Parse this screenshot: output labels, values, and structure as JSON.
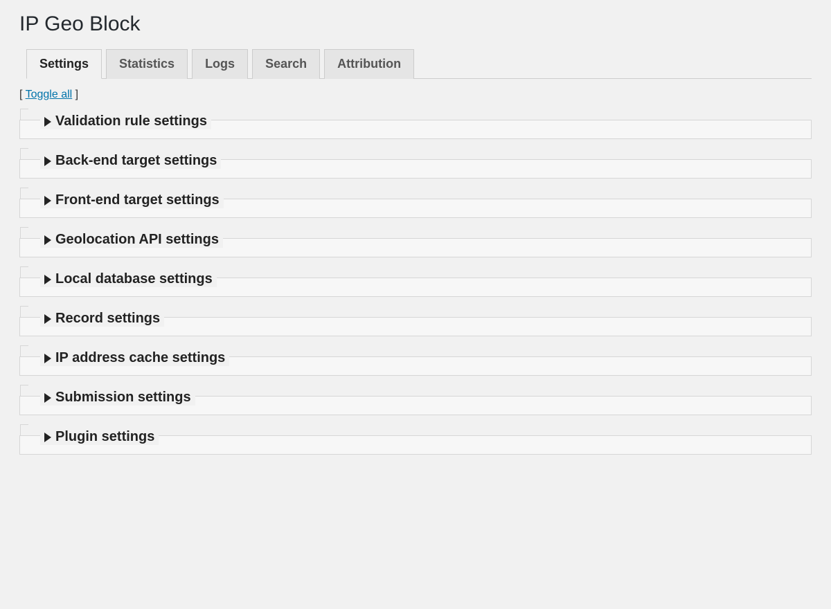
{
  "header": {
    "title": "IP Geo Block"
  },
  "tabs": [
    {
      "label": "Settings",
      "active": true
    },
    {
      "label": "Statistics",
      "active": false
    },
    {
      "label": "Logs",
      "active": false
    },
    {
      "label": "Search",
      "active": false
    },
    {
      "label": "Attribution",
      "active": false
    }
  ],
  "toggle_all": {
    "bracket_open": "[ ",
    "link": "Toggle all",
    "bracket_close": " ]"
  },
  "sections": [
    {
      "title": "Validation rule settings"
    },
    {
      "title": "Back-end target settings"
    },
    {
      "title": "Front-end target settings"
    },
    {
      "title": "Geolocation API settings"
    },
    {
      "title": "Local database settings"
    },
    {
      "title": "Record settings"
    },
    {
      "title": "IP address cache settings"
    },
    {
      "title": "Submission settings"
    },
    {
      "title": "Plugin settings"
    }
  ]
}
